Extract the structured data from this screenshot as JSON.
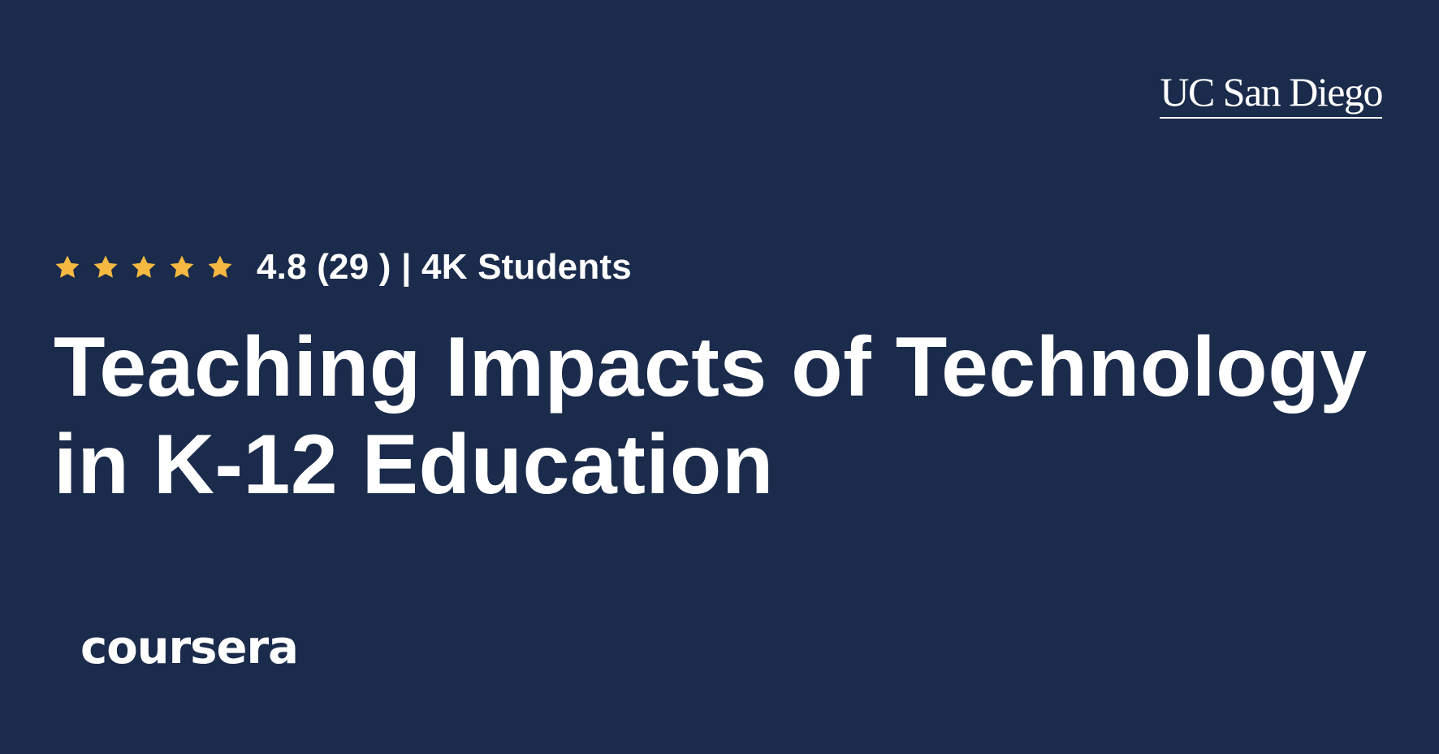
{
  "partner": {
    "logo_text": "UC San Diego"
  },
  "rating": {
    "stars_filled": 5,
    "stars_total": 5,
    "star_color": "#f5b942",
    "summary": "4.8 (29 ) | 4K Students"
  },
  "course": {
    "title": "Teaching Impacts of Technology in K-12 Education"
  },
  "platform": {
    "logo_text": "coursera"
  },
  "colors": {
    "background": "#1b2b4b",
    "text": "#ffffff"
  }
}
